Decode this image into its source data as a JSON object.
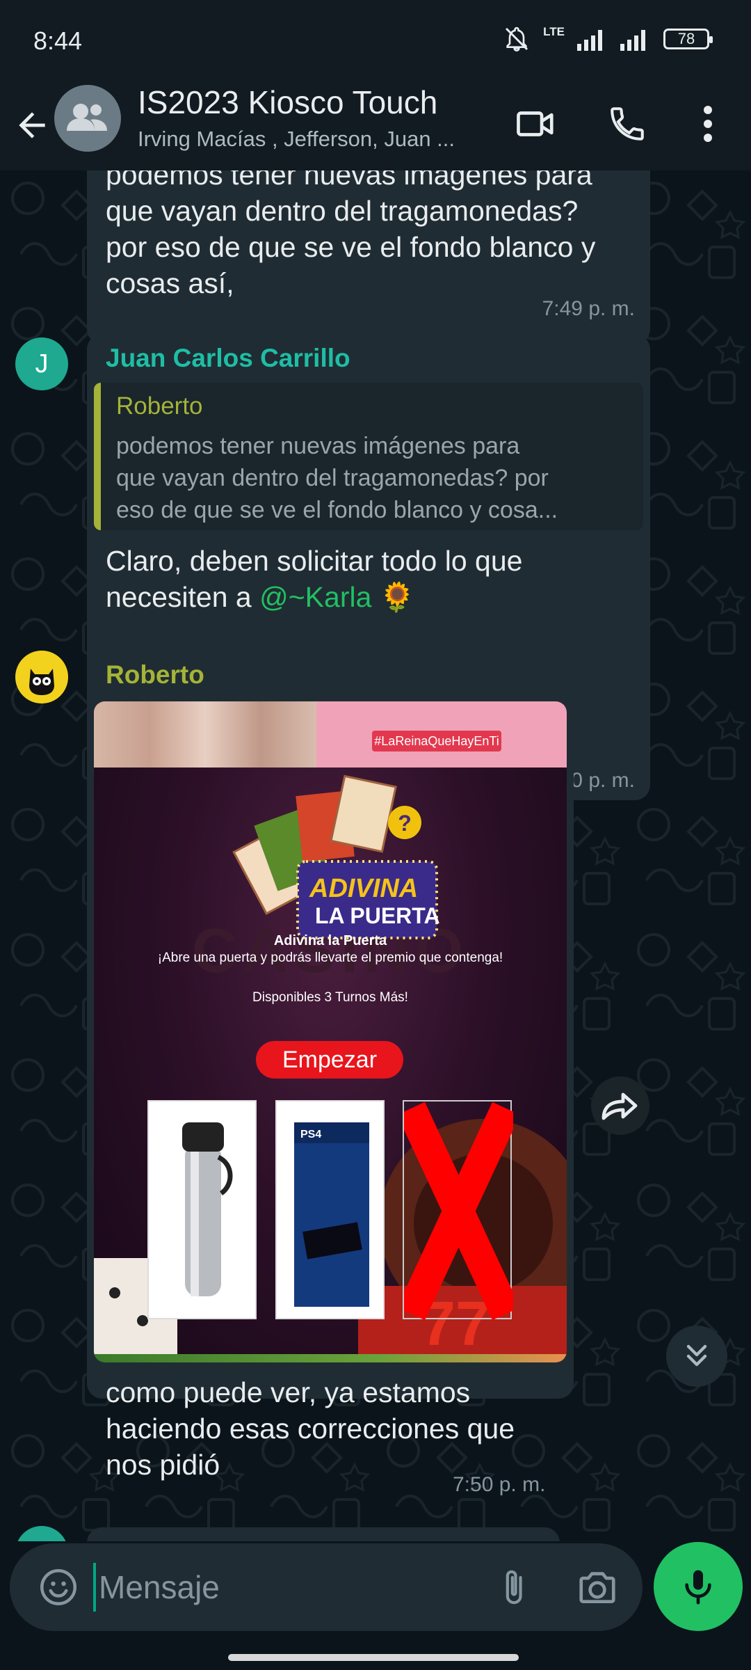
{
  "status_bar": {
    "time": "8:44",
    "network": "LTE",
    "battery": "78"
  },
  "header": {
    "title": "IS2023 Kiosco Touch",
    "subtitle": "Irving Macías , Jefferson, Juan ..."
  },
  "messages": [
    {
      "text": "podemos tener nuevas imágenes para que vayan dentro del tragamonedas? por eso de que se ve el fondo blanco y cosas así,",
      "line_top": "podemos tener nuevas imágenes para",
      "line_2": "que vayan dentro del tragamonedas?",
      "line_3": "por eso de que se ve el fondo blanco y",
      "line_4": "cosas así,",
      "time": "7:49 p. m."
    },
    {
      "sender": "Juan Carlos Carrillo",
      "avatar_letter": "J",
      "quote_author": "Roberto",
      "quote_line_1": "podemos tener nuevas imágenes para",
      "quote_line_2": "que vayan dentro del tragamonedas? por",
      "quote_line_3": "eso de que se ve el fondo blanco y cosa...",
      "line_1": "Claro, deben solicitar todo lo que",
      "line_2_prefix": "necesiten a ",
      "mention": "@~Karla",
      "emoji": "🌻",
      "time": "7:50 p. m."
    },
    {
      "sender": "Roberto",
      "image": {
        "hashtag": "#LaReinaQueHayEnTi",
        "logo_top": "ADIVINA",
        "logo_bottom": "LA PUERTA",
        "bg_word": "CASINO",
        "title": "Adivina la Puerta",
        "subtitle": "¡Abre una puerta y podrás llevarte el premio que contenga!",
        "turns": "Disponibles 3 Turnos Más!",
        "button": "Empezar",
        "ps4_label": "PS4"
      },
      "line_1": "como puede ver, ya estamos",
      "line_2": "haciendo esas correcciones que",
      "line_3": "nos pidió",
      "time": "7:50 p. m."
    }
  ],
  "composer": {
    "placeholder": "Mensaje"
  },
  "colors": {
    "accent": "#21c063",
    "sender_juan": "#1ebea5",
    "sender_roberto": "#a5b337",
    "mention": "#21c063"
  },
  "icons": [
    "back-arrow-icon",
    "group-icon",
    "video-call-icon",
    "phone-icon",
    "more-vert-icon",
    "forward-icon",
    "scroll-down-icon",
    "emoji-icon",
    "attach-icon",
    "camera-icon",
    "mic-icon",
    "mute-icon",
    "signal-icon"
  ]
}
